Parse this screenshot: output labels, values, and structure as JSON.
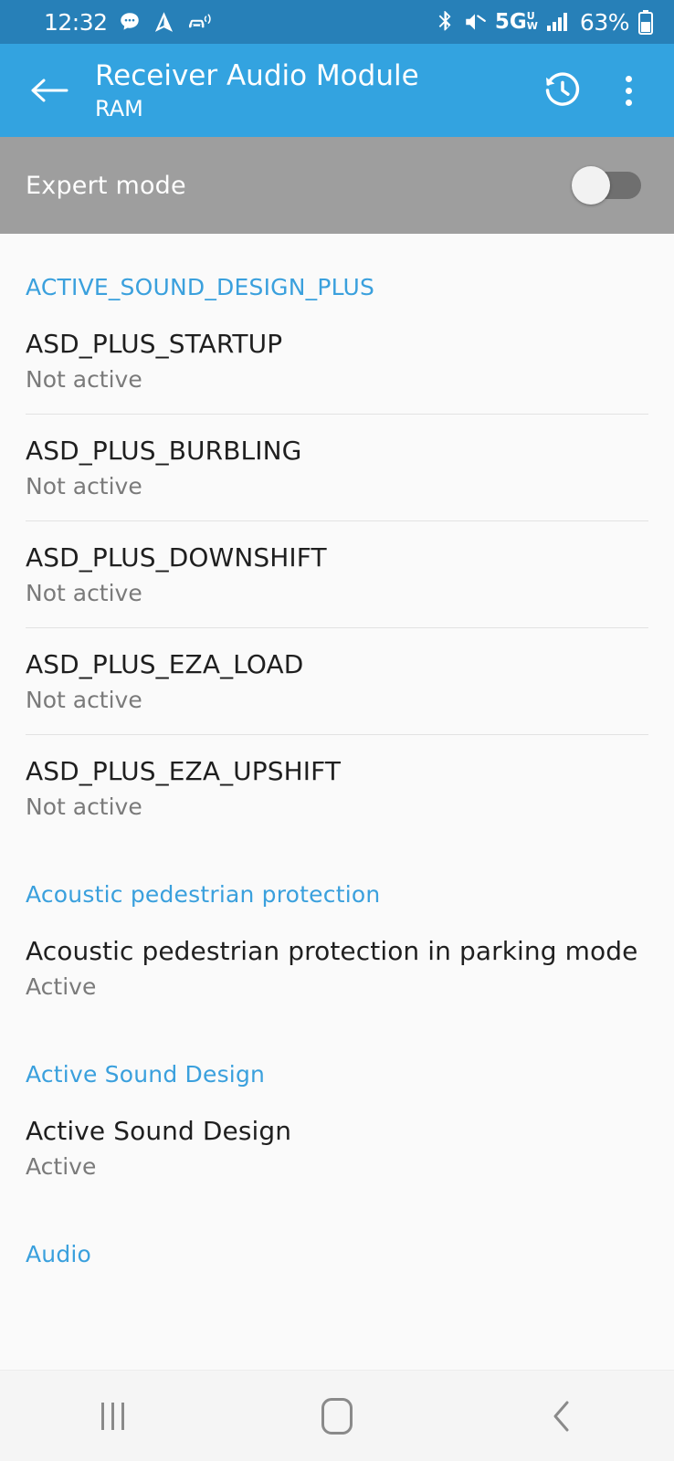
{
  "status_bar": {
    "time": "12:32",
    "battery_percent": "63%",
    "network": "5G",
    "network_sub": "UW",
    "icons": [
      "message-bubble-icon",
      "navigation-arrow-icon",
      "car-connected-icon",
      "bluetooth-icon",
      "mute-icon",
      "signal-bars-icon",
      "battery-icon"
    ],
    "background_color": "#2780b8"
  },
  "app_bar": {
    "title": "Receiver Audio Module",
    "subtitle": "RAM",
    "back_label": "Back",
    "history_label": "History",
    "overflow_label": "More options",
    "background_color": "#33a3e0"
  },
  "expert_mode": {
    "label": "Expert mode",
    "enabled": false,
    "background_color": "#9e9e9e"
  },
  "accent_color": "#3aa0dd",
  "sections": [
    {
      "header": "ACTIVE_SOUND_DESIGN_PLUS",
      "items": [
        {
          "title": "ASD_PLUS_STARTUP",
          "status": "Not active"
        },
        {
          "title": "ASD_PLUS_BURBLING",
          "status": "Not active"
        },
        {
          "title": "ASD_PLUS_DOWNSHIFT",
          "status": "Not active"
        },
        {
          "title": "ASD_PLUS_EZA_LOAD",
          "status": "Not active"
        },
        {
          "title": "ASD_PLUS_EZA_UPSHIFT",
          "status": "Not active"
        }
      ]
    },
    {
      "header": "Acoustic pedestrian protection",
      "items": [
        {
          "title": "Acoustic pedestrian protection in parking mode",
          "status": "Active"
        }
      ]
    },
    {
      "header": "Active Sound Design",
      "items": [
        {
          "title": "Active Sound Design",
          "status": "Active"
        }
      ]
    },
    {
      "header": "Audio",
      "items": []
    }
  ],
  "nav_bar": {
    "recents_label": "Recents",
    "home_label": "Home",
    "back_label": "Back"
  }
}
